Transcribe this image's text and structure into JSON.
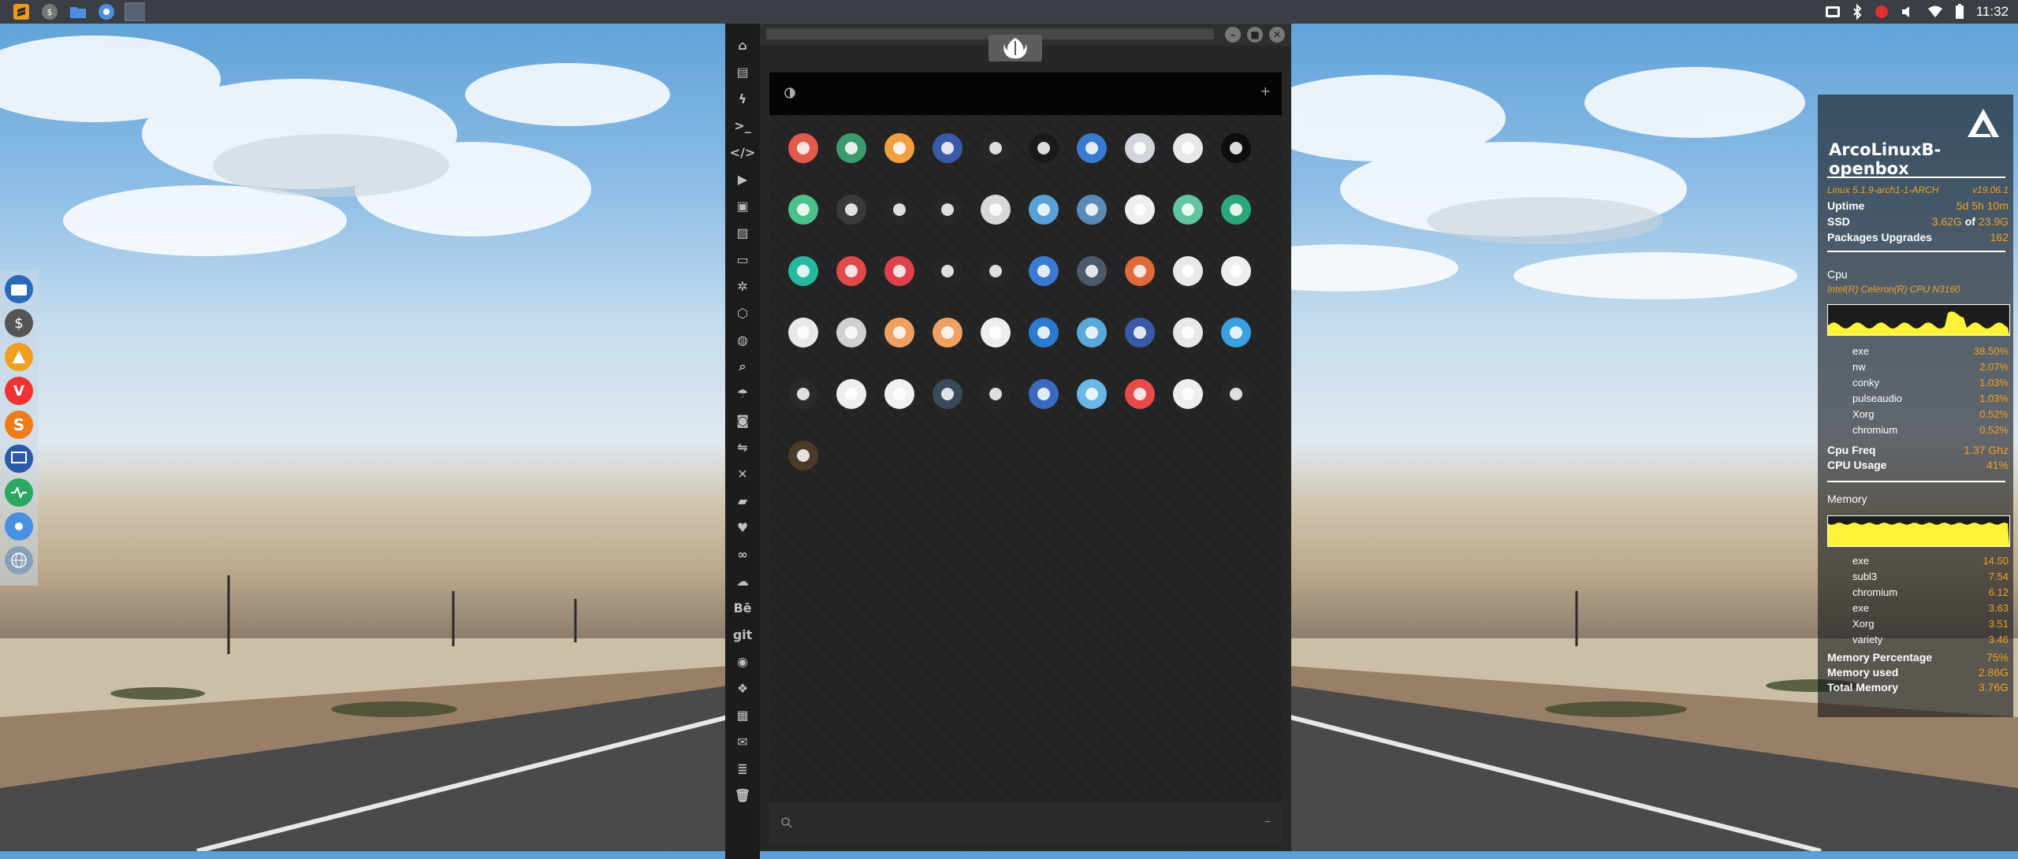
{
  "top_panel": {
    "launchers": [
      "sublime-icon",
      "money-icon",
      "folder-icon",
      "chromium-icon",
      "workspace-icon"
    ],
    "tray": [
      "screenshot-icon",
      "bluetooth-icon",
      "notification-icon",
      "volume-icon",
      "wifi-icon",
      "battery-icon"
    ],
    "clock": "11:32"
  },
  "dock": {
    "items": [
      "files-icon",
      "money-icon",
      "vlc-icon",
      "vivaldi-icon",
      "sublime-icon",
      "screen-icon",
      "health-icon",
      "chromium-icon",
      "globe-icon"
    ]
  },
  "launcher": {
    "sidebar_items": [
      {
        "icon": "home-icon",
        "glyph": "⌂"
      },
      {
        "icon": "document-icon",
        "glyph": "▤"
      },
      {
        "icon": "lightning-icon",
        "glyph": "ϟ"
      },
      {
        "icon": "terminal-icon",
        "glyph": ">_"
      },
      {
        "icon": "code-icon",
        "glyph": "</>"
      },
      {
        "icon": "play-icon",
        "glyph": "▶"
      },
      {
        "icon": "media-icon",
        "glyph": "▣"
      },
      {
        "icon": "image-icon",
        "glyph": "▨"
      },
      {
        "icon": "id-card-icon",
        "glyph": "▭"
      },
      {
        "icon": "settings-icon",
        "glyph": "✲"
      },
      {
        "icon": "hexagon-icon",
        "glyph": "⬡"
      },
      {
        "icon": "globe-icon",
        "glyph": "◍"
      },
      {
        "icon": "search-icon",
        "glyph": "⌕"
      },
      {
        "icon": "umbrella-icon",
        "glyph": "☂"
      },
      {
        "icon": "contact-icon",
        "glyph": "◙"
      },
      {
        "icon": "sync-icon",
        "glyph": "⇋"
      },
      {
        "icon": "fullscreen-icon",
        "glyph": "✕"
      },
      {
        "icon": "youtube-icon",
        "glyph": "▰"
      },
      {
        "icon": "heart-icon",
        "glyph": "♥"
      },
      {
        "icon": "creative-cloud-icon",
        "glyph": "∞"
      },
      {
        "icon": "cloud-icon",
        "glyph": "☁"
      },
      {
        "icon": "behance-icon",
        "glyph": "Bē"
      },
      {
        "icon": "git-icon",
        "glyph": "git"
      },
      {
        "icon": "github-icon",
        "glyph": "◉"
      },
      {
        "icon": "cubes-icon",
        "glyph": "❖"
      },
      {
        "icon": "map-icon",
        "glyph": "▦"
      },
      {
        "icon": "mail-icon",
        "glyph": "✉"
      },
      {
        "icon": "server-icon",
        "glyph": "≣"
      },
      {
        "icon": "trash-icon",
        "glyph": "🗑"
      }
    ],
    "apps": [
      {
        "icon": "warning-icon",
        "bg": "#e35a4a"
      },
      {
        "icon": "yandex-icon",
        "bg": "#3d9a6e"
      },
      {
        "icon": "search-app-icon",
        "bg": "#f0a040"
      },
      {
        "icon": "hourglass-icon",
        "bg": "#3a5aa8"
      },
      {
        "icon": "sublime-arrow-icon",
        "bg": "#272727"
      },
      {
        "icon": "terminal-app-icon",
        "bg": "#1a1a1a"
      },
      {
        "icon": "web-browser-icon",
        "bg": "#3a7ad0"
      },
      {
        "icon": "disk-icon",
        "bg": "#d0d6dc"
      },
      {
        "icon": "window-icon",
        "bg": "#e8e8e8"
      },
      {
        "icon": "terminal-dark-icon",
        "bg": "#0e0e0e"
      },
      {
        "icon": "cloud-lock-icon",
        "bg": "#4bbf8c"
      },
      {
        "icon": "github-app-icon",
        "bg": "#3a3a3a"
      },
      {
        "icon": "starfleet-icon",
        "bg": "#272727"
      },
      {
        "icon": "death-star-icon",
        "bg": "#272727"
      },
      {
        "icon": "moon-icon",
        "bg": "#d8d8d8"
      },
      {
        "icon": "world-map-icon",
        "bg": "#5aa0d8"
      },
      {
        "icon": "book-icon",
        "bg": "#5a8ab8"
      },
      {
        "icon": "notepad-icon",
        "bg": "#eeeeee"
      },
      {
        "icon": "music-icon",
        "bg": "#5fc6a0"
      },
      {
        "icon": "video-icon",
        "bg": "#2aa87a"
      },
      {
        "icon": "play-app-icon",
        "bg": "#27b9a0"
      },
      {
        "icon": "video-player-icon",
        "bg": "#e04a4a"
      },
      {
        "icon": "close-app-icon",
        "bg": "#e0404a"
      },
      {
        "icon": "ironman-icon",
        "bg": "#272727"
      },
      {
        "icon": "c3po-icon",
        "bg": "#272727"
      },
      {
        "icon": "translate-icon",
        "bg": "#3a7ad0"
      },
      {
        "icon": "calculator-icon",
        "bg": "#4a5a6a"
      },
      {
        "icon": "color-picker-icon",
        "bg": "#e06a3a"
      },
      {
        "icon": "chemistry-icon",
        "bg": "#e8e8e8"
      },
      {
        "icon": "text-file-icon",
        "bg": "#eeeeee"
      },
      {
        "icon": "fonts-icon",
        "bg": "#e8e8e8"
      },
      {
        "icon": "list-icon",
        "bg": "#d0d0d0"
      },
      {
        "icon": "document-app-icon",
        "bg": "#f0a060"
      },
      {
        "icon": "image-viewer-icon",
        "bg": "#f0a060"
      },
      {
        "icon": "presentation-icon",
        "bg": "#eeeeee"
      },
      {
        "icon": "vscode-icon",
        "bg": "#2a7ad0"
      },
      {
        "icon": "network-icon",
        "bg": "#5aa8d8"
      },
      {
        "icon": "disk-usage-icon",
        "bg": "#3a5aa8"
      },
      {
        "icon": "umbrella-app-icon",
        "bg": "#e8e8e8"
      },
      {
        "icon": "weather-icon",
        "bg": "#3aa0e0"
      },
      {
        "icon": "equalizer-icon",
        "bg": "#2a2a2a"
      },
      {
        "icon": "calendar-icon",
        "bg": "#eeeeee"
      },
      {
        "icon": "calendar-alt-icon",
        "bg": "#f0f0f0"
      },
      {
        "icon": "clock-icon",
        "bg": "#3a4a5a"
      },
      {
        "icon": "colors-icon",
        "bg": "#272727"
      },
      {
        "icon": "earth-icon",
        "bg": "#3a6ac0"
      },
      {
        "icon": "mail-app-icon",
        "bg": "#6ab8e8"
      },
      {
        "icon": "gmail-icon",
        "bg": "#e84a4a"
      },
      {
        "icon": "google-drive-icon",
        "bg": "#eeeeee"
      },
      {
        "icon": "pyramid-icon",
        "bg": "#272727"
      },
      {
        "icon": "radio-icon",
        "bg": "#4a3a2a"
      }
    ]
  },
  "conky": {
    "hostname": "ArcoLinuxB-openbox",
    "kernel": "Linux 5.1.9-arch1-1-ARCH",
    "version": "v19.06.1",
    "uptime": {
      "label": "Uptime",
      "value": "5d 5h 10m"
    },
    "ssd": {
      "label": "SSD",
      "used": "3.62G",
      "of": "of",
      "total": "23.9G"
    },
    "packages": {
      "label": "Packages Upgrades",
      "value": "162"
    },
    "cpu_heading": "Cpu",
    "cpu_model": "Intel(R) Celeron(R) CPU  N3160",
    "cpu_procs": [
      {
        "name": "exe",
        "value": "38.50%"
      },
      {
        "name": "nw",
        "value": "2.07%"
      },
      {
        "name": "conky",
        "value": "1.03%"
      },
      {
        "name": "pulseaudio",
        "value": "1.03%"
      },
      {
        "name": "Xorg",
        "value": "0.52%"
      },
      {
        "name": "chromium",
        "value": "0.52%"
      }
    ],
    "cpu_freq": {
      "label": "Cpu Freq",
      "value": "1.37 Ghz"
    },
    "cpu_usage": {
      "label": "CPU Usage",
      "value": "41%"
    },
    "memory_heading": "Memory",
    "mem_procs": [
      {
        "name": "exe",
        "value": "14.50"
      },
      {
        "name": "subl3",
        "value": "7.54"
      },
      {
        "name": "chromium",
        "value": "6.12"
      },
      {
        "name": "exe",
        "value": "3.63"
      },
      {
        "name": "Xorg",
        "value": "3.51"
      },
      {
        "name": "variety",
        "value": "3.46"
      }
    ],
    "mem_percentage": {
      "label": "Memory Percentage",
      "value": "75%"
    },
    "mem_used": {
      "label": "Memory used",
      "value": "2.86G"
    },
    "mem_total": {
      "label": "Total Memory",
      "value": "3.76G"
    },
    "colors": {
      "accent": "#f0a020",
      "graph": "#fff33a"
    }
  }
}
